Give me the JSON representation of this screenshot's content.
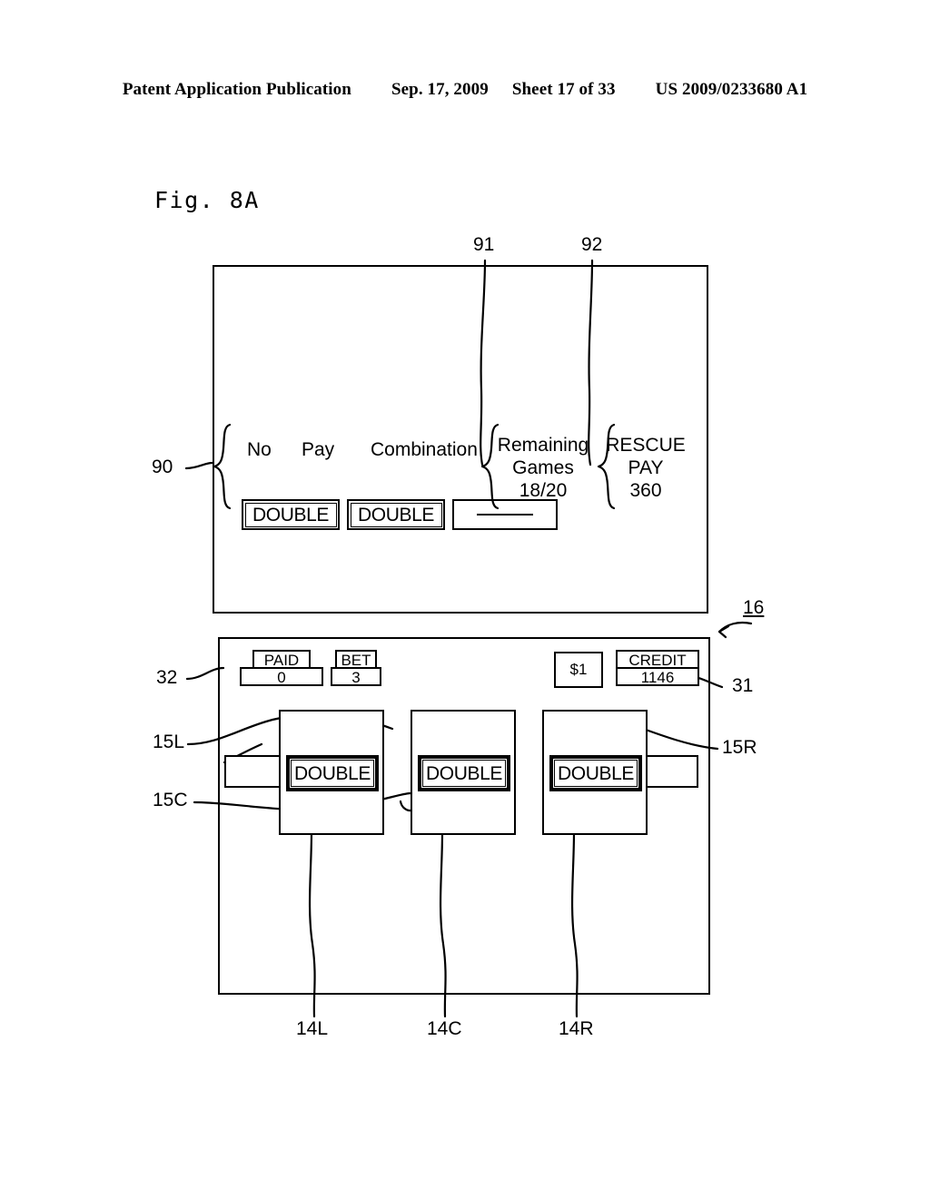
{
  "header": {
    "publication": "Patent Application Publication",
    "date": "Sep. 17, 2009",
    "sheet": "Sheet 17 of 33",
    "docnum": "US 2009/0233680 A1"
  },
  "figure": {
    "label": "Fig. 8A"
  },
  "upper_display": {
    "columns": {
      "no": "No",
      "pay": "Pay",
      "combination": "Combination"
    },
    "remaining_games": {
      "line1": "Remaining",
      "line2": "Games",
      "value": "18/20"
    },
    "rescue_pay": {
      "line1": "RESCUE",
      "line2": "PAY",
      "value": "360"
    },
    "values": {
      "no": "DOUBLE",
      "pay": "DOUBLE",
      "combination": "—"
    }
  },
  "lower_panel": {
    "meters": {
      "paid_label": "PAID",
      "paid_value": "0",
      "bet_label": "BET",
      "bet_value": "3",
      "denomination": "$1",
      "credit_label": "CREDIT",
      "credit_value": "1146"
    },
    "reels": {
      "left_symbol": "DOUBLE",
      "center_symbol": "DOUBLE",
      "right_symbol": "DOUBLE"
    }
  },
  "reference_numerals": {
    "n90": "90",
    "n91": "91",
    "n92": "92",
    "n16": "16",
    "n31": "31",
    "n32": "32",
    "n15L": "15L",
    "n15C": "15C",
    "n15R": "15R",
    "n14L": "14L",
    "n14C": "14C",
    "n14R": "14R"
  },
  "colors": {
    "ink": "#000000",
    "paper": "#ffffff"
  }
}
